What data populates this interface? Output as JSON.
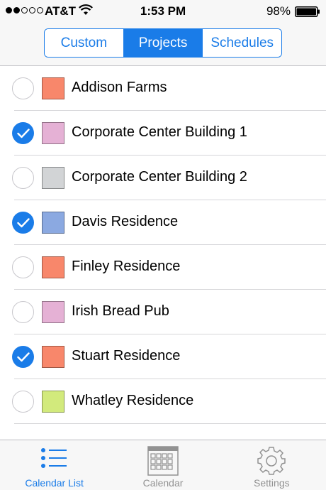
{
  "status_bar": {
    "carrier": "AT&T",
    "time": "1:53 PM",
    "battery": "98%",
    "signal_bars_filled": 2,
    "signal_bars_total": 5
  },
  "segments": [
    {
      "label": "Custom",
      "active": false
    },
    {
      "label": "Projects",
      "active": true
    },
    {
      "label": "Schedules",
      "active": false
    }
  ],
  "projects": [
    {
      "name": "Addison Farms",
      "checked": false,
      "color": "#f8876b"
    },
    {
      "name": "Corporate Center Building 1",
      "checked": true,
      "color": "#e5b1d5"
    },
    {
      "name": "Corporate Center Building 2",
      "checked": false,
      "color": "#d2d4d6"
    },
    {
      "name": "Davis Residence",
      "checked": true,
      "color": "#8ba9e1"
    },
    {
      "name": "Finley Residence",
      "checked": false,
      "color": "#f8876b"
    },
    {
      "name": "Irish Bread Pub",
      "checked": false,
      "color": "#e5b1d5"
    },
    {
      "name": "Stuart Residence",
      "checked": true,
      "color": "#f8876b"
    },
    {
      "name": "Whatley Residence",
      "checked": false,
      "color": "#d2ea7c"
    }
  ],
  "tabs": [
    {
      "label": "Calendar List",
      "icon": "list-icon",
      "active": true
    },
    {
      "label": "Calendar",
      "icon": "calendar-icon",
      "active": false
    },
    {
      "label": "Settings",
      "icon": "gear-icon",
      "active": false
    }
  ],
  "colors": {
    "accent": "#1a7ce8"
  }
}
